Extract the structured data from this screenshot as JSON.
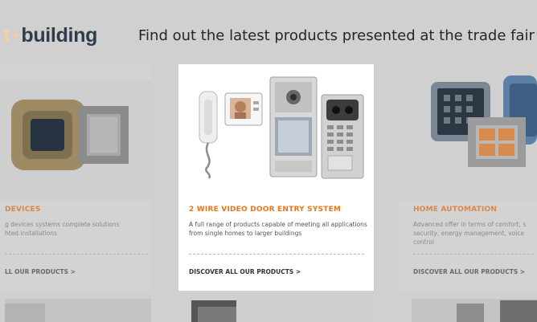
{
  "header": {
    "brand_prefix": "t",
    "brand_plus": "+",
    "brand_word": "building",
    "headline": "Find out the latest products presented at the trade fair"
  },
  "cards": {
    "left": {
      "title": "DEVICES",
      "desc": "g devices systems complete solutions\nhted installations",
      "link": "LL OUR PRODUCTS >"
    },
    "center": {
      "title": "2 WIRE VIDEO DOOR ENTRY SYSTEM",
      "desc": "A full range of products capable of meeting all applications from single homes to larger buildings",
      "link": "DISCOVER ALL OUR PRODUCTS >"
    },
    "right": {
      "title": "HOME AUTOMATION",
      "desc": "Advanced offer in terms of comfort, s security, energy management, voice control",
      "link": "DISCOVER ALL OUR PRODUCTS >"
    }
  },
  "colors": {
    "accent_orange": "#e6761c",
    "brand_dark": "#2f3d4a",
    "overlay_gray": "#d0d0d0"
  }
}
